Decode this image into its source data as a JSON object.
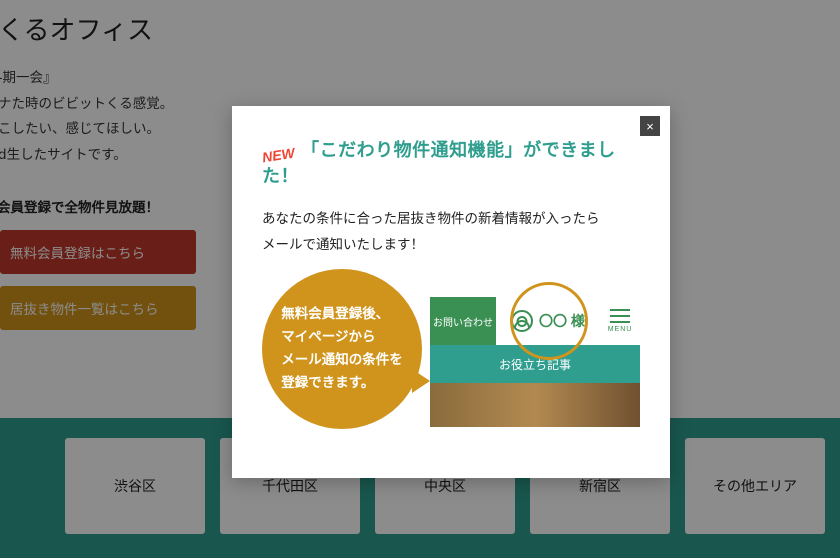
{
  "hero": {
    "title_fragment": "くるオフィス",
    "line1": "-期一会』",
    "line2": "ナた時のビビットくる感覚。",
    "line3": "こしたい、感じてほしい。",
    "line4": "ⅾ生したサイトです。"
  },
  "promo": {
    "header": "会員登録で全物件見放題！",
    "register_btn": "無料会員登録はこちら",
    "list_btn": "居抜き物件一覧はこちら"
  },
  "areas": [
    "渋谷区",
    "千代田区",
    "中央区",
    "新宿区",
    "その他エリア"
  ],
  "modal": {
    "new": "NEW",
    "headline": "「こだわり物件通知機能」ができました！",
    "sub1": "あなたの条件に合った居抜き物件の新着情報が入ったら",
    "sub2": "メールで通知いたします！",
    "speech": "無料会員登録後、\nマイページから\nメール通知の条件を\n登録できます。",
    "mini": {
      "contact": "お問い合わせ",
      "user": "〇〇 様",
      "menu": "MENU",
      "bluebar": "お役立ち記事"
    },
    "close": "×"
  }
}
